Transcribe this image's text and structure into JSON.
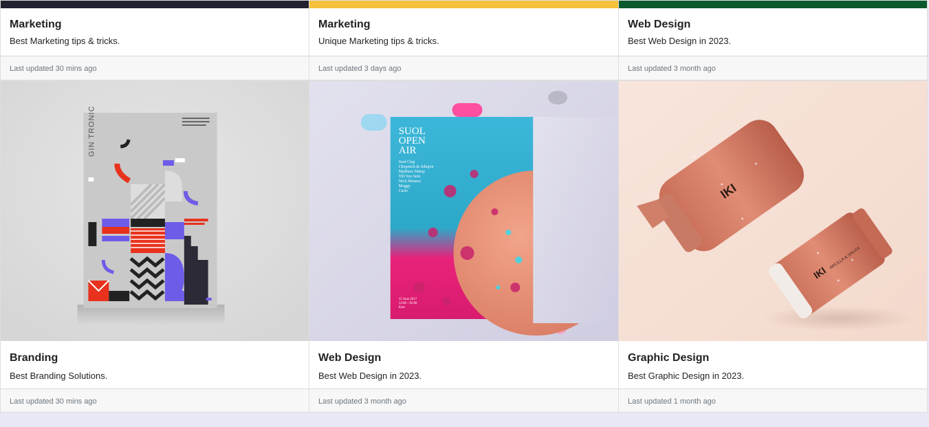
{
  "top_cards": [
    {
      "title": "Marketing",
      "text": "Best Marketing tips & tricks.",
      "footer": "Last updated 30 mins ago",
      "strip_color": "#22212f"
    },
    {
      "title": "Marketing",
      "text": "Unique Marketing tips & tricks.",
      "footer": "Last updated 3 days ago",
      "strip_color": "#f7c13b"
    },
    {
      "title": "Web Design",
      "text": "Best Web Design in 2023.",
      "footer": "Last updated 3 month ago",
      "strip_color": "#0b5a2e"
    }
  ],
  "image_cards": [
    {
      "title": "Branding",
      "text": "Best Branding Solutions.",
      "footer": "Last updated 30 mins ago",
      "image_label": "GIN TRONIC"
    },
    {
      "title": "Web Design",
      "text": "Best Web Design in 2023.",
      "footer": "Last updated 3 month ago",
      "poster_title_lines": [
        "SUOL",
        "OPEN",
        "AIR"
      ],
      "poster_lineup": [
        "Soul Clap",
        "Chopstick & Johnjon",
        "Matthew Dekay",
        "Till Von Sein",
        "Nick Monaco",
        "Moggy",
        "Carlo"
      ],
      "poster_footer_lines": [
        "15 June 2017",
        "12:00 - 02:00",
        "Kiez"
      ]
    },
    {
      "title": "Graphic Design",
      "text": "Best Graphic Design in 2023.",
      "footer": "Last updated 1 month ago",
      "brand_mark": "IKI",
      "product_text": "ARCILLA & SALVIA"
    }
  ],
  "colors": {
    "page_bg": "#e8e8f7",
    "footer_bg": "#f7f7f7",
    "accent_purple": "#6d5ce8",
    "accent_red": "#e8321d"
  }
}
